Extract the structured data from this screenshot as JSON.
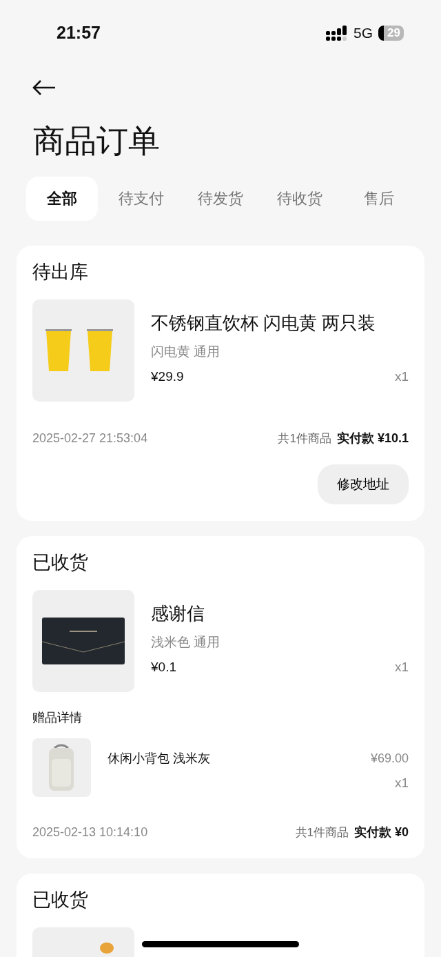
{
  "status_bar": {
    "time": "21:57",
    "network": "5G",
    "battery": "29"
  },
  "header": {
    "title": "商品订单"
  },
  "tabs": [
    {
      "label": "全部",
      "selected": true
    },
    {
      "label": "待支付",
      "selected": false
    },
    {
      "label": "待发货",
      "selected": false
    },
    {
      "label": "待收货",
      "selected": false
    },
    {
      "label": "售后",
      "selected": false
    }
  ],
  "orders": [
    {
      "status": "待出库",
      "items": [
        {
          "kind": "picture",
          "name": "不锈钢直饮杯 闪电黄 两只装",
          "spec": "闪电黄 通用",
          "price": "¥29.9",
          "qty": "x1"
        }
      ],
      "time": "2025-02-27 21:53:04",
      "count": "共1件商品",
      "paid": "实付款 ¥10.1",
      "buttons": [
        "修改地址"
      ]
    },
    {
      "status": "已收货",
      "items": [
        {
          "kind": "picture",
          "name": "感谢信",
          "spec": "浅米色 通用",
          "price": "¥0.1",
          "qty": "x1"
        }
      ],
      "gifts_title": "赠品详情",
      "gifts": [
        {
          "kind": "picture",
          "name": "休闲小背包 浅米灰",
          "price": "¥69.00",
          "qty": "x1"
        }
      ],
      "time": "2025-02-13 10:14:10",
      "count": "共1件商品",
      "paid": "实付款 ¥0"
    },
    {
      "status": "已收货"
    }
  ]
}
